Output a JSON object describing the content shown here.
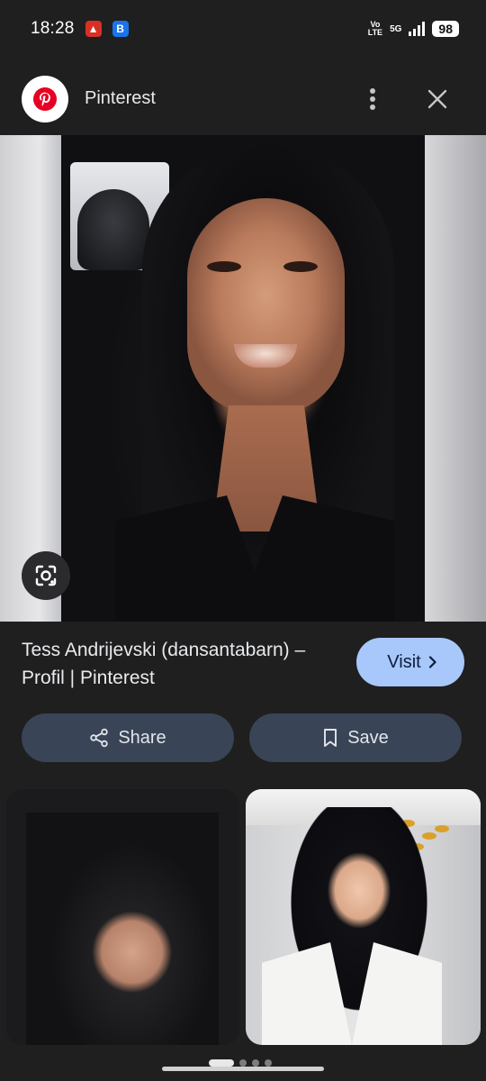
{
  "status_bar": {
    "time": "18:28",
    "network_volte": "Vo\nLTE",
    "network_type": "5G",
    "battery": "98"
  },
  "header": {
    "source_name": "Pinterest",
    "source_logo_icon": "pinterest-logo-icon",
    "more_icon": "more-vert-icon",
    "close_icon": "close-icon"
  },
  "result": {
    "title": "Tess Andrijevski (dansantabarn) – Profil | Pinterest",
    "visit_label": "Visit",
    "share_label": "Share",
    "save_label": "Save"
  },
  "colors": {
    "background": "#1f1f1f",
    "visit_button": "#a8c7fa",
    "action_button": "#394457",
    "pinterest_red": "#e60023"
  }
}
